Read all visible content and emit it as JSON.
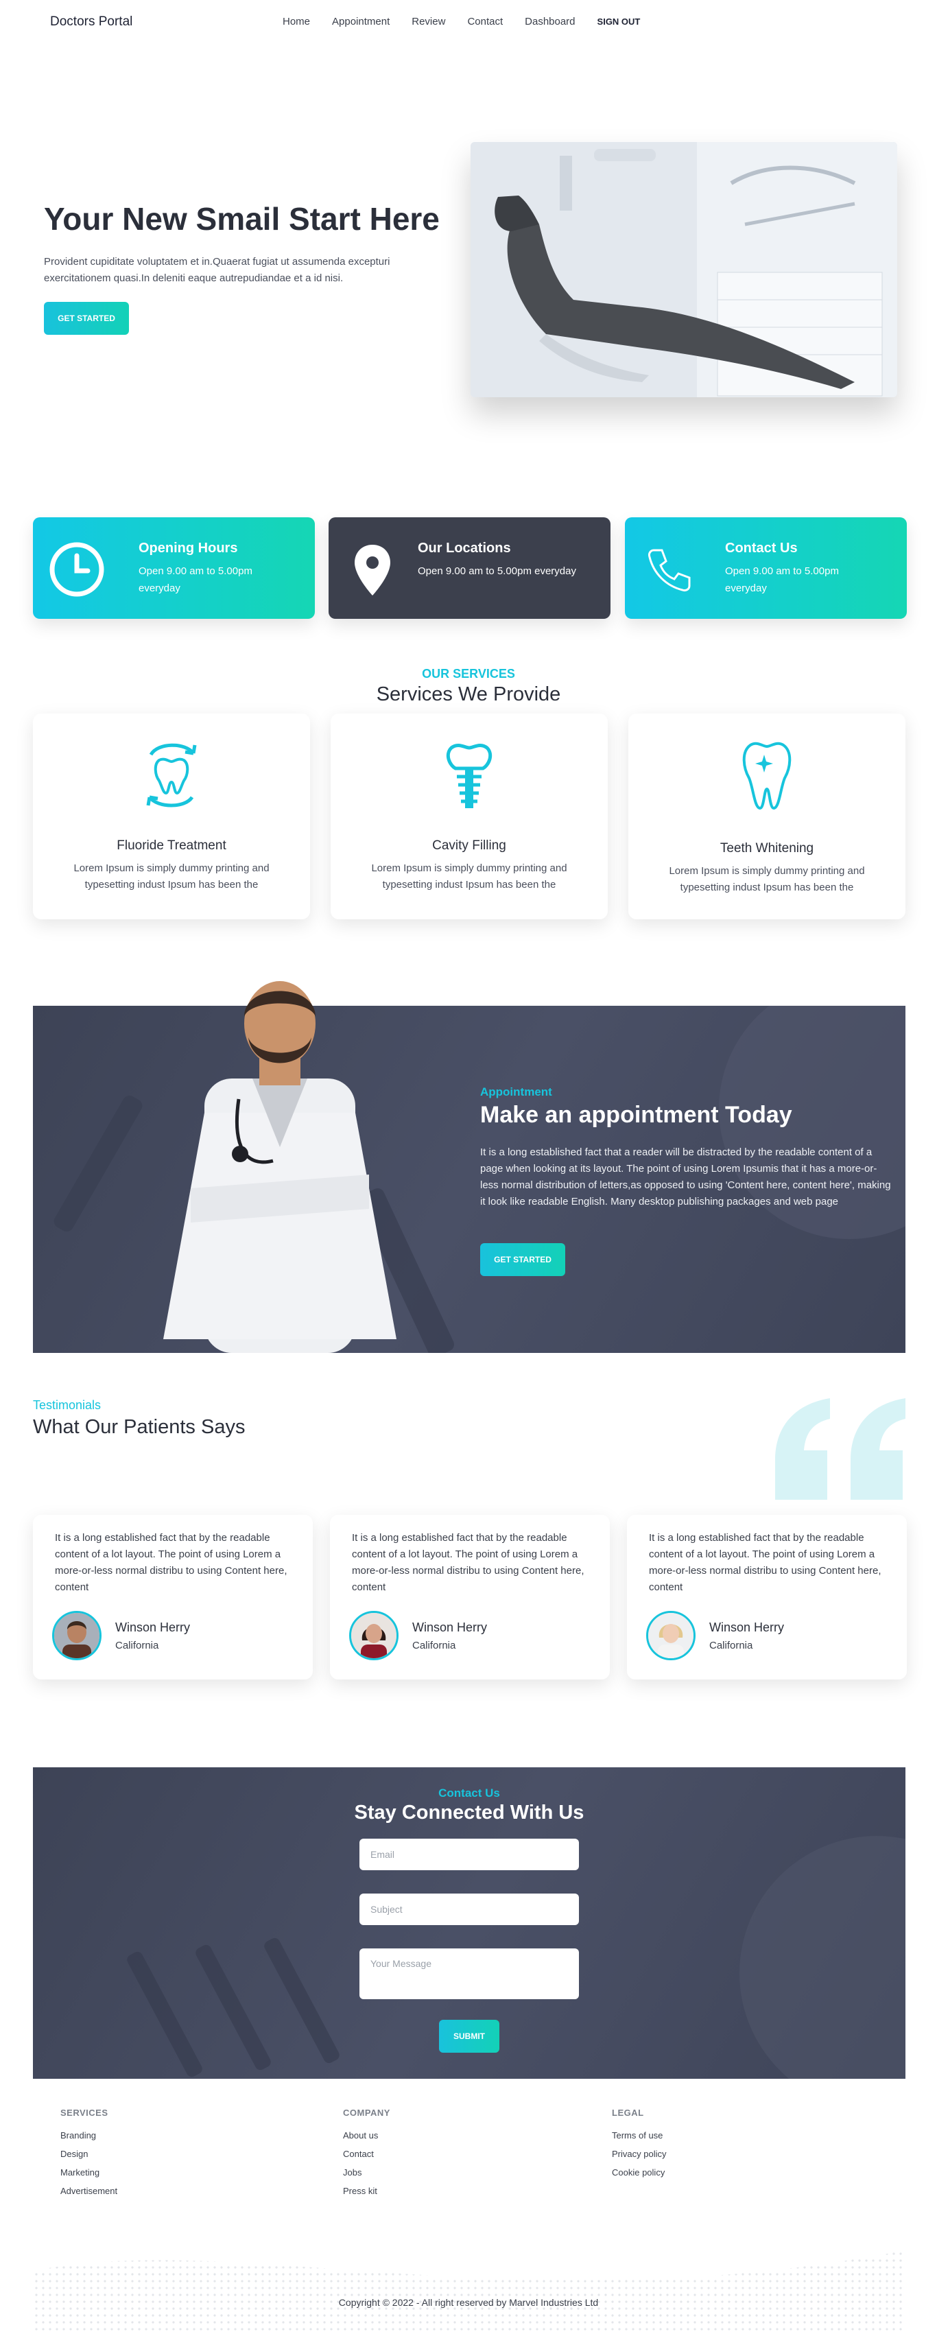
{
  "nav": {
    "brand": "Doctors Portal",
    "links": [
      "Home",
      "Appointment",
      "Review",
      "Contact",
      "Dashboard",
      "SIGN OUT"
    ]
  },
  "hero": {
    "title": "Your New Smail Start Here",
    "text": "Provident cupiditate voluptatem et in.Quaerat fugiat ut assumenda excepturi exercitationem quasi.In deleniti eaque autrepudiandae et a id nisi.",
    "button": "GET STARTED"
  },
  "info_cards": [
    {
      "title": "Opening Hours",
      "text": "Open 9.00 am to 5.00pm everyday",
      "icon": "clock-icon"
    },
    {
      "title": "Our Locations",
      "text": "Open 9.00 am to 5.00pm everyday",
      "icon": "location-pin-icon"
    },
    {
      "title": "Contact Us",
      "text": "Open 9.00 am to 5.00pm everyday",
      "icon": "phone-icon"
    }
  ],
  "services": {
    "eyebrow": "OUR SERVICES",
    "title": "Services We Provide",
    "items": [
      {
        "title": "Fluoride Treatment",
        "text": "Lorem Ipsum is simply dummy printing and typesetting indust Ipsum has been the",
        "icon": "fluoride-tooth-icon"
      },
      {
        "title": "Cavity Filling",
        "text": "Lorem Ipsum is simply dummy printing and typesetting indust Ipsum has been the",
        "icon": "dental-implant-icon"
      },
      {
        "title": "Teeth Whitening",
        "text": "Lorem Ipsum is simply dummy printing and typesetting indust Ipsum has been the",
        "icon": "sparkling-tooth-icon"
      }
    ]
  },
  "appointment": {
    "eyebrow": "Appointment",
    "title": "Make an appointment Today",
    "text": "It is a long established fact that a reader will be distracted by the readable content of a page when looking at its layout. The point of using Lorem Ipsumis that it has a more-or-less normal distribution of letters,as opposed to using 'Content here, content here', making it look like readable English. Many desktop publishing packages and web page",
    "button": "GET STARTED"
  },
  "testimonials": {
    "eyebrow": "Testimonials",
    "title": "What Our Patients Says",
    "items": [
      {
        "text": "It is a long established fact that by the readable content of a lot layout. The point of using Lorem a more-or-less normal distribu to using Content here, content",
        "name": "Winson Herry",
        "location": "California"
      },
      {
        "text": "It is a long established fact that by the readable content of a lot layout. The point of using Lorem a more-or-less normal distribu to using Content here, content",
        "name": "Winson Herry",
        "location": "California"
      },
      {
        "text": "It is a long established fact that by the readable content of a lot layout. The point of using Lorem a more-or-less normal distribu to using Content here, content",
        "name": "Winson Herry",
        "location": "California"
      }
    ]
  },
  "contact": {
    "eyebrow": "Contact Us",
    "title": "Stay Connected With Us",
    "email_placeholder": "Email",
    "subject_placeholder": "Subject",
    "message_placeholder": "Your Message",
    "button": "SUBMIT"
  },
  "footer": {
    "columns": [
      {
        "heading": "SERVICES",
        "links": [
          "Branding",
          "Design",
          "Marketing",
          "Advertisement"
        ]
      },
      {
        "heading": "COMPANY",
        "links": [
          "About us",
          "Contact",
          "Jobs",
          "Press kit"
        ]
      },
      {
        "heading": "LEGAL",
        "links": [
          "Terms of use",
          "Privacy policy",
          "Cookie policy"
        ]
      }
    ],
    "copyright": "Copyright © 2022 - All right reserved by Marvel Industries Ltd"
  },
  "colors": {
    "accent": "#17c4dc",
    "accent_end": "#15d6b4",
    "dark": "#3c404d"
  }
}
